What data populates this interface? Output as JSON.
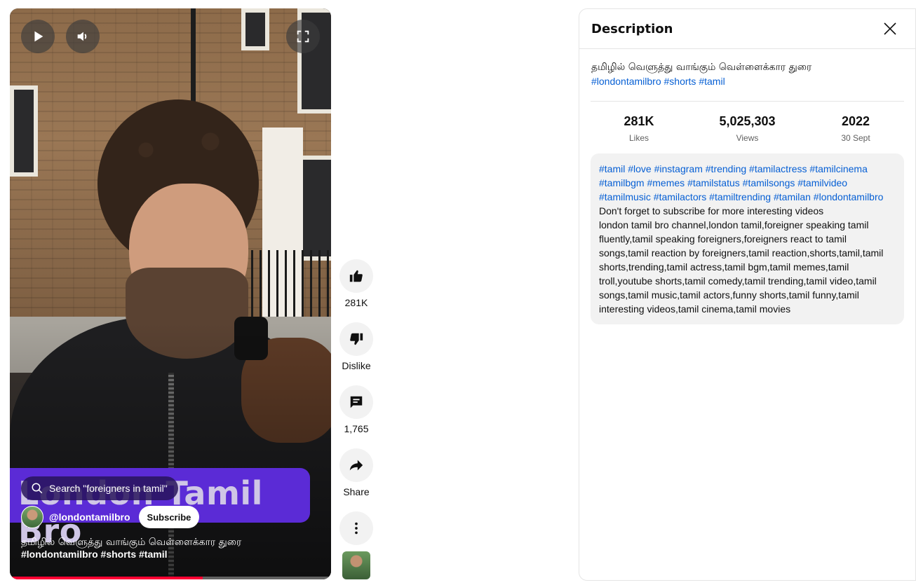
{
  "player": {
    "banner_text": "London Tamil Bro",
    "search_chip": "Search \"foreigners in tamil\"",
    "channel_handle": "@londontamilbro",
    "subscribe_label": "Subscribe",
    "title": "தமிழில் வெளுத்து வாங்கும் வெள்ளைக்கார துரை",
    "tags": "#londontamilbro #shorts #tamil",
    "progress": 0.6
  },
  "actions": {
    "like_count": "281K",
    "dislike_label": "Dislike",
    "comment_count": "1,765",
    "share_label": "Share"
  },
  "description": {
    "heading": "Description",
    "title": "தமிழில் வெளுத்து வாங்கும் வெள்ளைக்கார துரை",
    "title_tags": [
      "#londontamilbro",
      "#shorts",
      "#tamil"
    ],
    "stats": [
      {
        "value": "281K",
        "label": "Likes"
      },
      {
        "value": "5,025,303",
        "label": "Views"
      },
      {
        "value": "2022",
        "label": "30 Sept"
      }
    ],
    "hashtags": [
      "#tamil",
      "#love",
      "#instagram",
      "#trending",
      "#tamilactress",
      "#tamilcinema",
      "#tamilbgm",
      "#memes",
      "#tamilstatus",
      "#tamilsongs",
      "#tamilvideo",
      "#tamilmusic",
      "#tamilactors",
      "#tamiltrending",
      "#tamilan",
      "#londontamilbro"
    ],
    "subscribe_line": "Don't forget to subscribe for more interesting videos",
    "keywords": "london tamil bro channel,london tamil,foreigner speaking tamil fluently,tamil speaking foreigners,foreigners react to tamil songs,tamil reaction by foreigners,tamil reaction,shorts,tamil,tamil shorts,trending,tamil actress,tamil bgm,tamil memes,tamil troll,youtube shorts,tamil comedy,tamil trending,tamil video,tamil songs,tamil music,tamil actors,funny shorts,tamil funny,tamil interesting videos,tamil cinema,tamil movies"
  }
}
